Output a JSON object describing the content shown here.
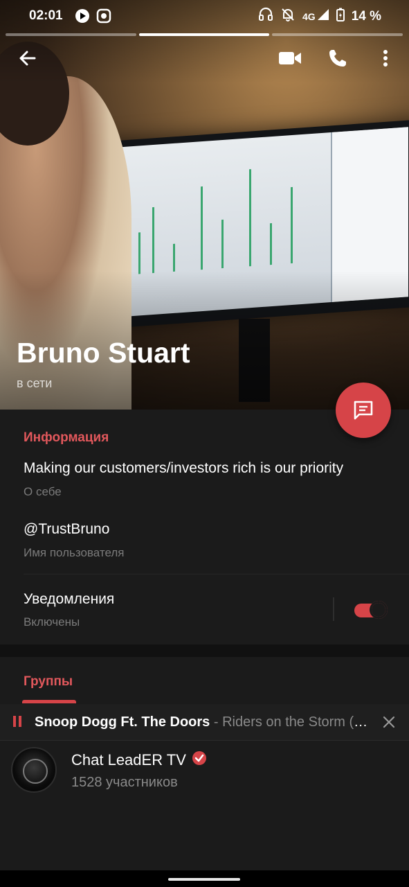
{
  "status_bar": {
    "time": "02:01",
    "network": "4G",
    "battery": "14 %"
  },
  "profile": {
    "name": "Bruno Stuart",
    "presence": "в сети"
  },
  "info": {
    "section_title": "Информация",
    "bio": "Making our customers/investors rich is our priority",
    "bio_label": "О себе",
    "username": "@TrustBruno",
    "username_label": "Имя пользователя",
    "notifications": "Уведомления",
    "notifications_state": "Включены",
    "notifications_on": true
  },
  "groups": {
    "section_title": "Группы",
    "items": [
      {
        "name": "Chat LeadER TV",
        "members": "1528 участников",
        "verified": true
      }
    ]
  },
  "player": {
    "artist": "Snoop Dogg Ft. The Doors",
    "song": " - Riders on the Storm (Fredwreck Remix)"
  },
  "colors": {
    "accent": "#d64448",
    "background": "#1b1b1b"
  }
}
